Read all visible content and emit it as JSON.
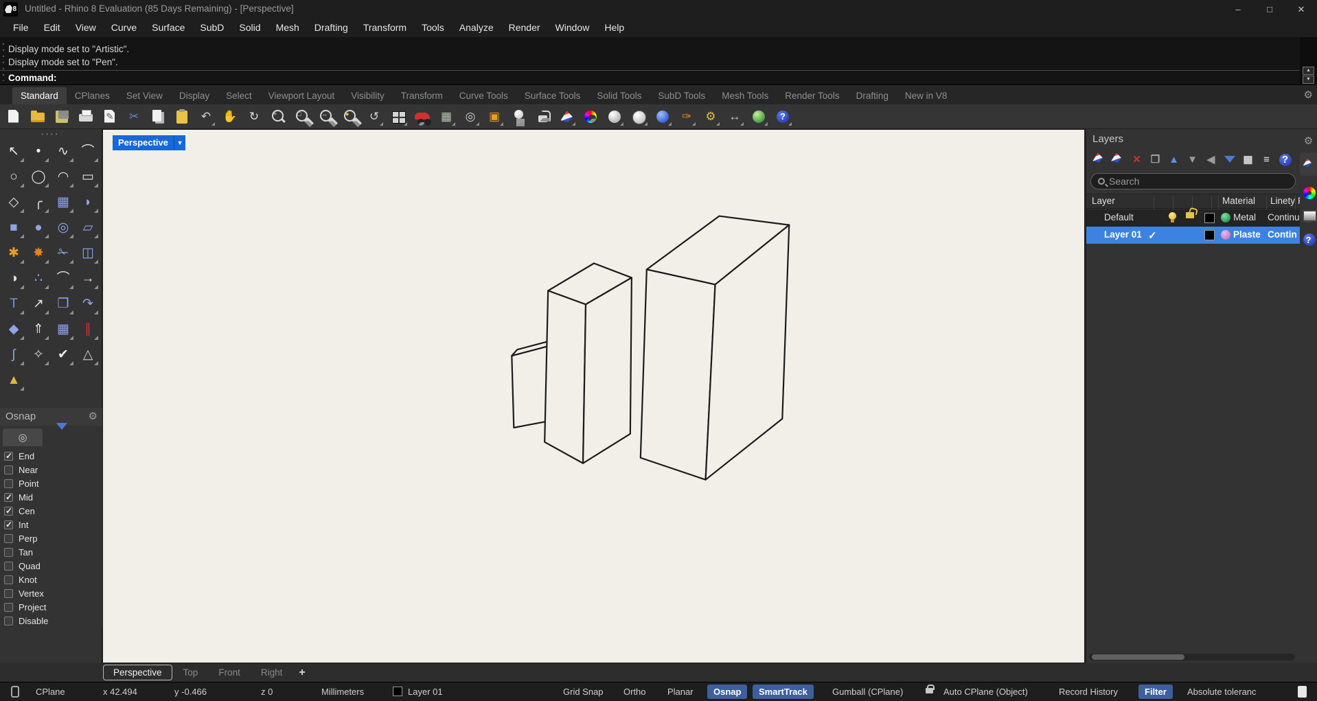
{
  "window": {
    "title": "Untitled - Rhino 8 Evaluation (85 Days Remaining) - [Perspective]",
    "minimize": "–",
    "maximize": "□",
    "close": "✕"
  },
  "menu": {
    "items": [
      {
        "label": "File",
        "name": "menu-file"
      },
      {
        "label": "Edit",
        "name": "menu-edit"
      },
      {
        "label": "View",
        "name": "menu-view"
      },
      {
        "label": "Curve",
        "name": "menu-curve"
      },
      {
        "label": "Surface",
        "name": "menu-surface"
      },
      {
        "label": "SubD",
        "name": "menu-subd"
      },
      {
        "label": "Solid",
        "name": "menu-solid"
      },
      {
        "label": "Mesh",
        "name": "menu-mesh"
      },
      {
        "label": "Drafting",
        "name": "menu-drafting"
      },
      {
        "label": "Transform",
        "name": "menu-transform"
      },
      {
        "label": "Tools",
        "name": "menu-tools"
      },
      {
        "label": "Analyze",
        "name": "menu-analyze"
      },
      {
        "label": "Render",
        "name": "menu-render"
      },
      {
        "label": "Window",
        "name": "menu-window"
      },
      {
        "label": "Help",
        "name": "menu-help"
      }
    ]
  },
  "command": {
    "history": [
      {
        "text": "Display mode set to \"Artistic\"."
      },
      {
        "text": "Display mode set to \"Pen\"."
      }
    ],
    "prompt": "Command:",
    "scroll_up": "▲",
    "scroll_down": "▼"
  },
  "toolbar_tabs": {
    "gear": "⚙",
    "items": [
      {
        "label": "Standard",
        "cls": "active",
        "name": "tab-standard"
      },
      {
        "label": "CPlanes",
        "name": "tab-cplanes"
      },
      {
        "label": "Set View",
        "name": "tab-set-view"
      },
      {
        "label": "Display",
        "name": "tab-display"
      },
      {
        "label": "Select",
        "name": "tab-select"
      },
      {
        "label": "Viewport Layout",
        "name": "tab-viewport-layout"
      },
      {
        "label": "Visibility",
        "name": "tab-visibility"
      },
      {
        "label": "Transform",
        "name": "tab-transform"
      },
      {
        "label": "Curve Tools",
        "name": "tab-curve-tools"
      },
      {
        "label": "Surface Tools",
        "name": "tab-surface-tools"
      },
      {
        "label": "Solid Tools",
        "name": "tab-solid-tools"
      },
      {
        "label": "SubD Tools",
        "name": "tab-subd-tools"
      },
      {
        "label": "Mesh Tools",
        "name": "tab-mesh-tools"
      },
      {
        "label": "Render Tools",
        "name": "tab-render-tools"
      },
      {
        "label": "Drafting",
        "name": "tab-drafting"
      },
      {
        "label": "New in V8",
        "name": "tab-new-in-v8"
      }
    ]
  },
  "main_toolbar": {
    "icons": [
      {
        "name": "new-file-icon",
        "cls": "i-page"
      },
      {
        "name": "open-file-icon",
        "cls": "i-folder"
      },
      {
        "name": "save-icon",
        "cls": "i-floppy fly"
      },
      {
        "name": "print-icon",
        "cls": "i-printer"
      },
      {
        "name": "edit-annotate-icon",
        "cls": "i-page",
        "glyph": "✎",
        "color": "#555555"
      },
      {
        "name": "cut-icon",
        "glyph": "✂",
        "color": "#5a8ad8"
      },
      {
        "name": "copy-icon",
        "cls": "i-copy"
      },
      {
        "name": "paste-icon",
        "cls": "i-clip"
      },
      {
        "name": "undo-icon",
        "cls": "fly",
        "glyph": "↶",
        "color": "#cfcfcf"
      },
      {
        "name": "pan-icon",
        "glyph": "✋",
        "color": "#eeeeee"
      },
      {
        "name": "rotate-view-icon",
        "glyph": "↻",
        "color": "#dddddd"
      },
      {
        "name": "zoom-dynamic-icon",
        "cls": "i-mag",
        "glyph": "+",
        "color": "#dddddd"
      },
      {
        "name": "zoom-window-icon",
        "cls": "i-mag fly",
        "glyph": "□",
        "color": "#dddddd"
      },
      {
        "name": "zoom-extents-icon",
        "cls": "i-mag fly",
        "glyph": "↔",
        "color": "#dddddd"
      },
      {
        "name": "zoom-selected-icon",
        "cls": "i-mag fly",
        "glyph": "●",
        "color": "#e8c34a"
      },
      {
        "name": "undo-view-icon",
        "cls": "fly",
        "glyph": "↺",
        "color": "#cfcfcf"
      },
      {
        "name": "viewport-layout-icon",
        "cls": "i-grid4 fly"
      },
      {
        "name": "auto-cplane-car-icon",
        "cls": "i-car fly"
      },
      {
        "name": "cplane-grid-icon",
        "cls": "fly",
        "glyph": "▦",
        "color": "#b8c8b0"
      },
      {
        "name": "osnap-toggle-icon",
        "cls": "fly",
        "glyph": "◎",
        "color": "#cccccc"
      },
      {
        "name": "selection-filter-icon",
        "cls": "fly",
        "glyph": "▣",
        "color": "#e8a020"
      },
      {
        "name": "light-icon",
        "cls": "i-bulbW fly"
      },
      {
        "name": "lock-icon",
        "cls": "i-lock fly"
      },
      {
        "name": "layer-icon",
        "cls": "i-wedge fly"
      },
      {
        "name": "color-wheel-icon",
        "cls": "i-wheel fly"
      },
      {
        "name": "shaded-sphere-icon",
        "cls": "i-sph i-sphW fly"
      },
      {
        "name": "wireframe-sphere-icon",
        "cls": "i-sph i-sphWire fly"
      },
      {
        "name": "rendered-sphere-icon",
        "cls": "i-sph i-sphB fly"
      },
      {
        "name": "render-tool-icon",
        "cls": "fly",
        "glyph": "✑",
        "color": "#e8821a"
      },
      {
        "name": "options-icon",
        "cls": "fly",
        "glyph": "⚙",
        "color": "#e0b84a"
      },
      {
        "name": "dimension-icon",
        "cls": "fly",
        "glyph": "↔",
        "color": "#cccccc"
      },
      {
        "name": "earth-icon",
        "cls": "i-sph i-sphG fly"
      },
      {
        "name": "help-icon",
        "cls": "i-help fly",
        "glyph": "?"
      }
    ]
  },
  "sidebar_tools": {
    "icons": [
      {
        "name": "select-arrow-icon",
        "glyph": "↖",
        "color": "#f0f0f0"
      },
      {
        "name": "point-icon",
        "glyph": "•",
        "color": "#f0f0f0"
      },
      {
        "name": "control-point-curve-icon",
        "glyph": "∿",
        "color": "#e0e0e0"
      },
      {
        "name": "curve-through-points-icon",
        "glyph": "⌒",
        "color": "#e0e0e0"
      },
      {
        "name": "circle-icon",
        "glyph": "○",
        "color": "#e0e0e0"
      },
      {
        "name": "ellipse-icon",
        "glyph": "◯",
        "color": "#e0e0e0"
      },
      {
        "name": "arc-icon",
        "glyph": "◠",
        "color": "#e0e0e0"
      },
      {
        "name": "rectangle-icon",
        "glyph": "▭",
        "color": "#e0e0e0"
      },
      {
        "name": "polygon-icon",
        "glyph": "◇",
        "color": "#e0e0e0"
      },
      {
        "name": "fillet-curve-icon",
        "glyph": "╭",
        "color": "#e0e0e0"
      },
      {
        "name": "surface-from-points-icon",
        "glyph": "▦",
        "color": "#8fa3e8"
      },
      {
        "name": "curved-surface-icon",
        "glyph": "◗",
        "color": "#8fa3e8"
      },
      {
        "name": "box-icon",
        "glyph": "■",
        "color": "#8fa3e8"
      },
      {
        "name": "sphere-icon",
        "glyph": "●",
        "color": "#8fa3e8"
      },
      {
        "name": "torus-icon",
        "glyph": "◎",
        "color": "#8fa3e8"
      },
      {
        "name": "surface-patch-icon",
        "glyph": "▱",
        "color": "#8fa3e8"
      },
      {
        "name": "explode-icon",
        "glyph": "✱",
        "color": "#e8a020"
      },
      {
        "name": "blast-icon",
        "glyph": "✸",
        "color": "#e8821a"
      },
      {
        "name": "trim-icon",
        "glyph": "✁",
        "color": "#8fa3e8"
      },
      {
        "name": "split-icon",
        "glyph": "◫",
        "color": "#8fa3e8"
      },
      {
        "name": "boolean-icon",
        "glyph": "◑",
        "color": "#e0e0e0"
      },
      {
        "name": "boolean-two-icon",
        "glyph": "∴",
        "color": "#8fa3e8"
      },
      {
        "name": "blend-curve-icon",
        "glyph": "⌒",
        "color": "#e0e0e0"
      },
      {
        "name": "extend-curve-icon",
        "glyph": "→",
        "color": "#e0e0e0"
      },
      {
        "name": "text-icon",
        "glyph": "T",
        "color": "#7a90d8"
      },
      {
        "name": "move-icon",
        "glyph": "↗",
        "color": "#e0e0e0"
      },
      {
        "name": "copy-objects-icon",
        "glyph": "❐",
        "color": "#8fa3e8"
      },
      {
        "name": "rotate-icon",
        "glyph": "↷",
        "color": "#8fa3e8"
      },
      {
        "name": "solid-union-icon",
        "glyph": "◆",
        "color": "#8fa3e8"
      },
      {
        "name": "extrude-icon",
        "glyph": "⇑",
        "color": "#e0e0e0"
      },
      {
        "name": "array-icon",
        "glyph": "▦",
        "color": "#8fa3e8"
      },
      {
        "name": "distribute-icon",
        "glyph": "∥",
        "color": "#d03030"
      },
      {
        "name": "bend-icon",
        "glyph": "∫",
        "color": "#8fa3e8"
      },
      {
        "name": "constraint-icon",
        "glyph": "✧",
        "color": "#d0d0d0"
      },
      {
        "name": "check-icon",
        "glyph": "✔",
        "color": "#f0f0f0"
      },
      {
        "name": "primitives-icon",
        "glyph": "△",
        "color": "#d0d0d0"
      },
      {
        "name": "pyramid-icon",
        "glyph": "▲",
        "color": "#e0b83a"
      }
    ]
  },
  "osnap": {
    "title": "Osnap",
    "gear": "⚙",
    "tab1_glyph": "◎",
    "items": [
      {
        "label": "End",
        "cls": "checked"
      },
      {
        "label": "Near"
      },
      {
        "label": "Point"
      },
      {
        "label": "Mid",
        "cls": "checked"
      },
      {
        "label": "Cen",
        "cls": "checked"
      },
      {
        "label": "Int",
        "cls": "checked"
      },
      {
        "label": "Perp"
      },
      {
        "label": "Tan"
      },
      {
        "label": "Quad"
      },
      {
        "label": "Knot"
      },
      {
        "label": "Vertex"
      },
      {
        "label": "Project"
      },
      {
        "label": "Disable"
      }
    ]
  },
  "viewport": {
    "label": "Perspective",
    "dropdown_arrow": "▼",
    "tabs": [
      {
        "label": "Perspective",
        "cls": "active",
        "name": "vtab-perspective"
      },
      {
        "label": "Top",
        "name": "vtab-top"
      },
      {
        "label": "Front",
        "name": "vtab-front"
      },
      {
        "label": "Right",
        "name": "vtab-right"
      },
      {
        "label": "+",
        "cls": "add",
        "name": "vtab-add"
      }
    ]
  },
  "scene": {
    "display_mode": "Pen",
    "small_box": {
      "front": "596,330 649,316 652,425 599,435",
      "top": "596,330 604,321 657,307 649,316",
      "side": "649,316 657,307 660,416 652,425"
    },
    "medium_box": {
      "top": "649,235 716,195 771,216 704,255",
      "left": "649,235 704,255 700,487 644,456",
      "right": "704,255 771,216 769,444 700,487"
    },
    "large_box": {
      "top": "793,204 899,126 1001,139 893,226",
      "left": "793,204 893,226 879,511 784,479",
      "right": "893,226 1001,139 991,422 879,511"
    }
  },
  "layers": {
    "title": "Layers",
    "gear": "⚙",
    "search_placeholder": "Search",
    "header": {
      "layer": "Layer",
      "material": "Material",
      "linetype": "Linety",
      "extra": "P"
    },
    "toolbar": [
      {
        "name": "new-layer-icon",
        "cls": "i-wedge sm"
      },
      {
        "name": "new-sublayer-icon",
        "cls": "i-wedge sm"
      },
      {
        "name": "delete-layer-icon",
        "glyph": "✕",
        "color": "#d23030"
      },
      {
        "name": "duplicate-layer-icon",
        "glyph": "❐",
        "color": "#a8a8a8"
      },
      {
        "name": "move-up-icon",
        "glyph": "▲",
        "color": "#5b8fe8"
      },
      {
        "name": "move-down-icon",
        "glyph": "▼",
        "color": "#9a9a9a"
      },
      {
        "name": "move-left-icon",
        "glyph": "◀",
        "color": "#9a9a9a"
      },
      {
        "name": "filter-layers-icon",
        "cls": "i-funnel"
      },
      {
        "name": "columns-icon",
        "glyph": "▦",
        "color": "#d8d8d8"
      },
      {
        "name": "layer-menu-icon",
        "glyph": "≡",
        "color": "#e8e8e8"
      },
      {
        "name": "layer-help-icon",
        "cls": "i-help",
        "glyph": "?"
      }
    ],
    "rows": [
      {
        "name": "Default",
        "current_mark": "",
        "material": "Metal",
        "linetype": "Continu",
        "color": "#000000",
        "material_color1": "#7fe0a0",
        "material_color2": "#127a3a",
        "visible": true,
        "unlocked": true
      },
      {
        "name": "Layer 01",
        "current_mark": "✓",
        "material": "Plaste",
        "linetype": "Contin",
        "color": "#000000",
        "material_color1": "#f0b8ec",
        "material_color2": "#b06ab0",
        "selected": true
      }
    ]
  },
  "strip": {
    "gear": "⚙",
    "tabs": [
      {
        "name": "strip-layers-tab",
        "cls": "wedge"
      },
      {
        "name": "strip-display-tab",
        "cls": "wheel"
      },
      {
        "name": "strip-monitor-tab",
        "cls": "monitor"
      },
      {
        "name": "strip-help-tab",
        "cls": "help"
      }
    ]
  },
  "status": {
    "cplane": "CPlane",
    "x": "x 42.494",
    "y": "y -0.466",
    "z": "z 0",
    "units": "Millimeters",
    "layer": "Layer 01",
    "grid_snap": "Grid Snap",
    "ortho": "Ortho",
    "planar": "Planar",
    "osnap": "Osnap",
    "smarttrack": "SmartTrack",
    "gumball": "Gumball (CPlane)",
    "auto_cplane": "Auto CPlane (Object)",
    "record_history": "Record History",
    "filter": "Filter",
    "tolerance": "Absolute toleranc"
  }
}
